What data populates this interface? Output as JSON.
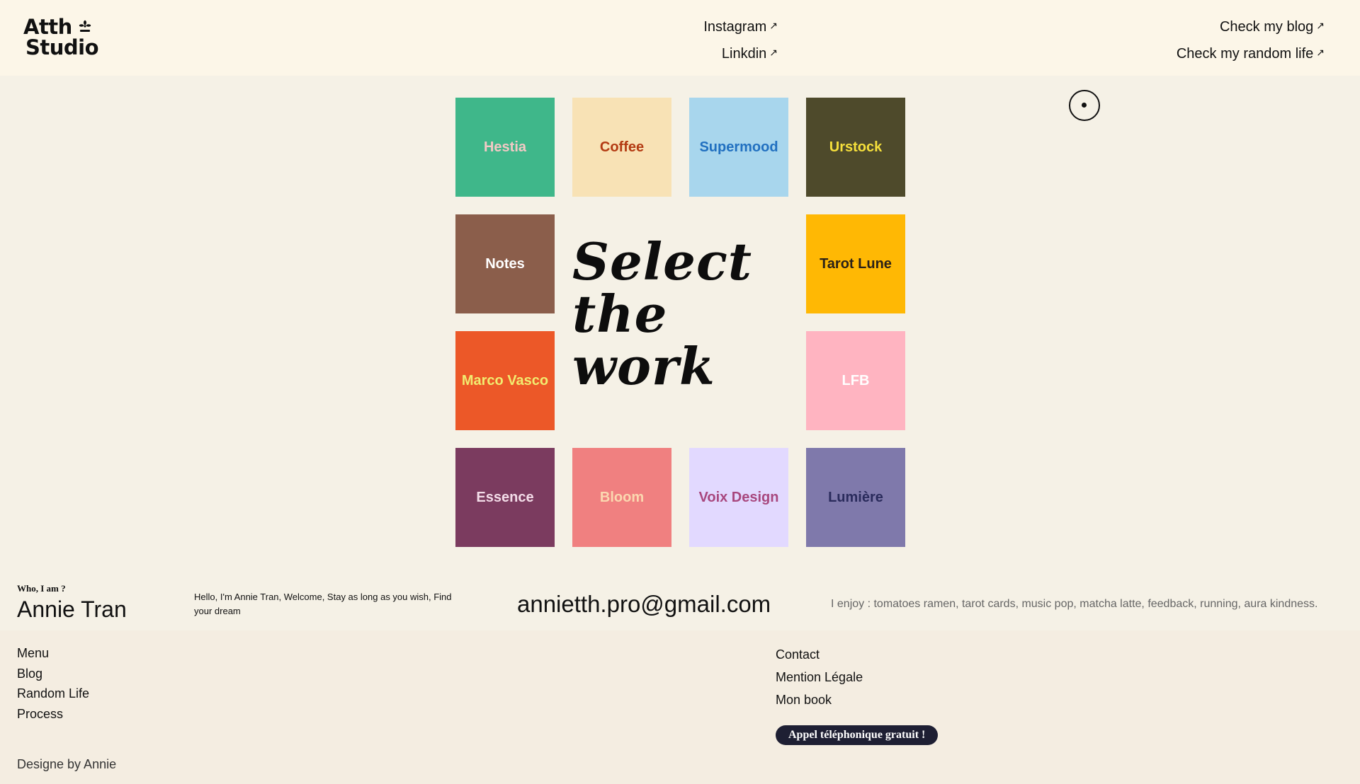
{
  "header": {
    "logo_line1": "Atth",
    "logo_line2": "Studio",
    "links": {
      "instagram": "Instagram",
      "linkedin": "Linkdin",
      "blog": "Check my blog",
      "random": "Check my random life"
    },
    "external_arrow": "↗"
  },
  "works": {
    "title": "Select\nthe\nwork",
    "tiles": [
      {
        "label": "Hestia",
        "bg": "#3fb78a",
        "fg": "#f3c9c5"
      },
      {
        "label": "Coffee",
        "bg": "#f8e2b5",
        "fg": "#b33a12"
      },
      {
        "label": "Supermood",
        "bg": "#a8d6ed",
        "fg": "#2170c0"
      },
      {
        "label": "Urstock",
        "bg": "#4e4a2b",
        "fg": "#f6e03b"
      },
      {
        "label": "Notes",
        "bg": "#8b5e4b",
        "fg": "#ffffff"
      },
      {
        "label": "Tarot Lune",
        "bg": "#ffb804",
        "fg": "#2a2118"
      },
      {
        "label": "Marco Vasco",
        "bg": "#ec5828",
        "fg": "#f1ec70"
      },
      {
        "label": "LFB",
        "bg": "#ffb4c1",
        "fg": "#ffffff"
      },
      {
        "label": "Essence",
        "bg": "#7b3b5f",
        "fg": "#f3dce8"
      },
      {
        "label": "Bloom",
        "bg": "#f08080",
        "fg": "#fbd8b0"
      },
      {
        "label": "Voix Design",
        "bg": "#e2d9ff",
        "fg": "#a8477e"
      },
      {
        "label": "Lumière",
        "bg": "#7f79ab",
        "fg": "#2a2b5c"
      }
    ]
  },
  "bio": {
    "who": "Who, I am ?",
    "name": "Annie Tran",
    "hello": "Hello, I'm Annie Tran, Welcome, Stay as long as you wish, Find your dream",
    "email": "annietth.pro@gmail.com",
    "enjoy": "I enjoy : tomatoes ramen, tarot cards, music pop, matcha latte, feedback, running, aura kindness."
  },
  "footer": {
    "menu": [
      "Menu",
      "Blog",
      "Random Life",
      "Process"
    ],
    "right": [
      "Contact",
      "Mention Légale",
      "Mon book"
    ],
    "cta": "Appel téléphonique gratuit !",
    "credit": "Designe by Annie"
  }
}
